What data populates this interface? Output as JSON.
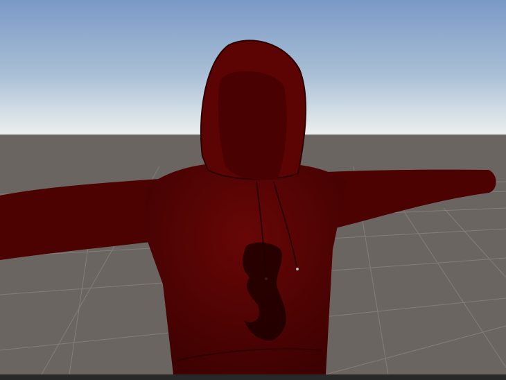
{
  "scene": {
    "sky_top": "#7d9cc8",
    "sky_horizon": "#e6ecee",
    "ground": "#6b6561",
    "grid_line": "#8d8884",
    "hoodie_color": "#5a0303",
    "hoodie_shadow": "#2e0000"
  }
}
